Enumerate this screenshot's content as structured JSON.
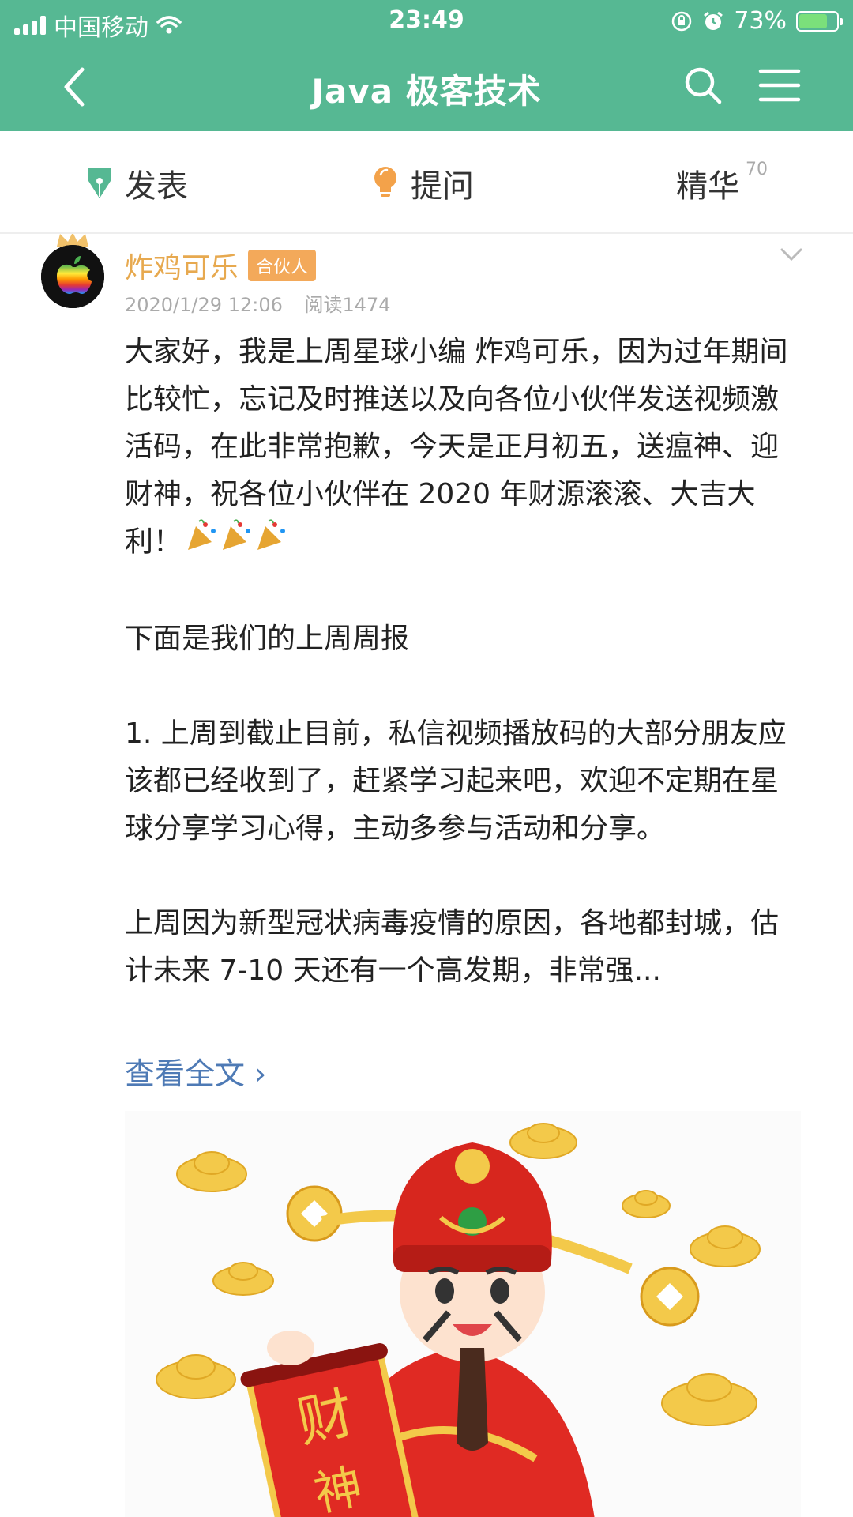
{
  "status_bar": {
    "carrier": "中国移动",
    "time": "23:49",
    "battery": "73%"
  },
  "nav": {
    "title": "Java 极客技术"
  },
  "tabs": [
    {
      "label": "发表"
    },
    {
      "label": "提问"
    },
    {
      "label": "精华",
      "count": "70"
    }
  ],
  "post": {
    "author": "炸鸡可乐",
    "badge": "合伙人",
    "date": "2020/1/29 12:06",
    "reads": "阅读1474",
    "paragraphs": [
      "大家好，我是上周星球小编 炸鸡可乐，因为过年期间比较忙，忘记及时推送以及向各位小伙伴发送视频激活码，在此非常抱歉，今天是正月初五，送瘟神、迎财神，祝各位小伙伴在 2020 年财源滚滚、大吉大利！",
      "下面是我们的上周周报",
      "1. 上周到截止目前，私信视频播放码的大部分朋友应该都已经收到了，赶紧学习起来吧，欢迎不定期在星球分享学习心得，主动多参与活动和分享。",
      "上周因为新型冠状病毒疫情的原因，各地都封城，估计未来 7-10 天还有一个高发期，非常强..."
    ],
    "read_more": "查看全文 ›",
    "scroll_text": [
      "财",
      "神"
    ]
  },
  "colors": {
    "primary": "#56b893",
    "author": "#e7a94f",
    "link": "#4e7ab5"
  }
}
